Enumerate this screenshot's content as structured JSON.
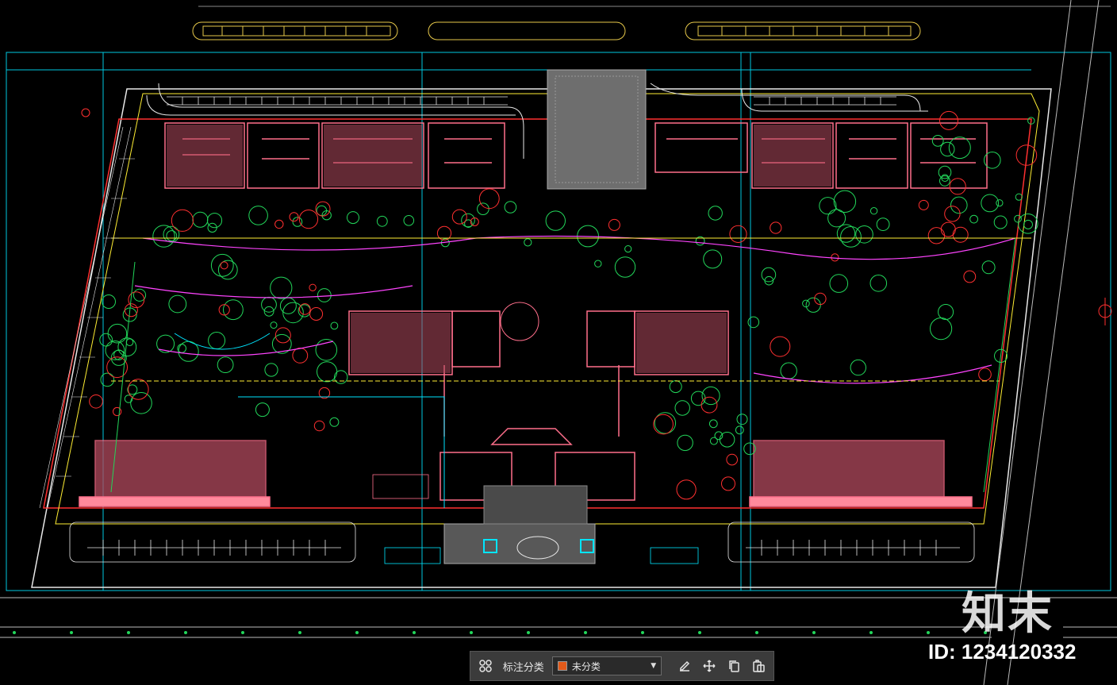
{
  "toolbar": {
    "category_label": "标注分类",
    "category_select": {
      "selected": "未分类",
      "swatch_color": "#e35a1a"
    },
    "icons": [
      "grid-icon",
      "edit-icon",
      "move-icon",
      "copy-icon",
      "paste-icon"
    ]
  },
  "watermark": {
    "brand": "知末",
    "id_text": "ID: 1234120332"
  },
  "colors": {
    "background": "#000000",
    "building": "#ff6f8b",
    "green": "#22d65a",
    "cyan": "#00e5ff",
    "yellow": "#ffee33",
    "magenta": "#ff44ff",
    "white": "#e8e8e8",
    "red": "#ff3030",
    "gray_block": "#8a8a8a"
  }
}
